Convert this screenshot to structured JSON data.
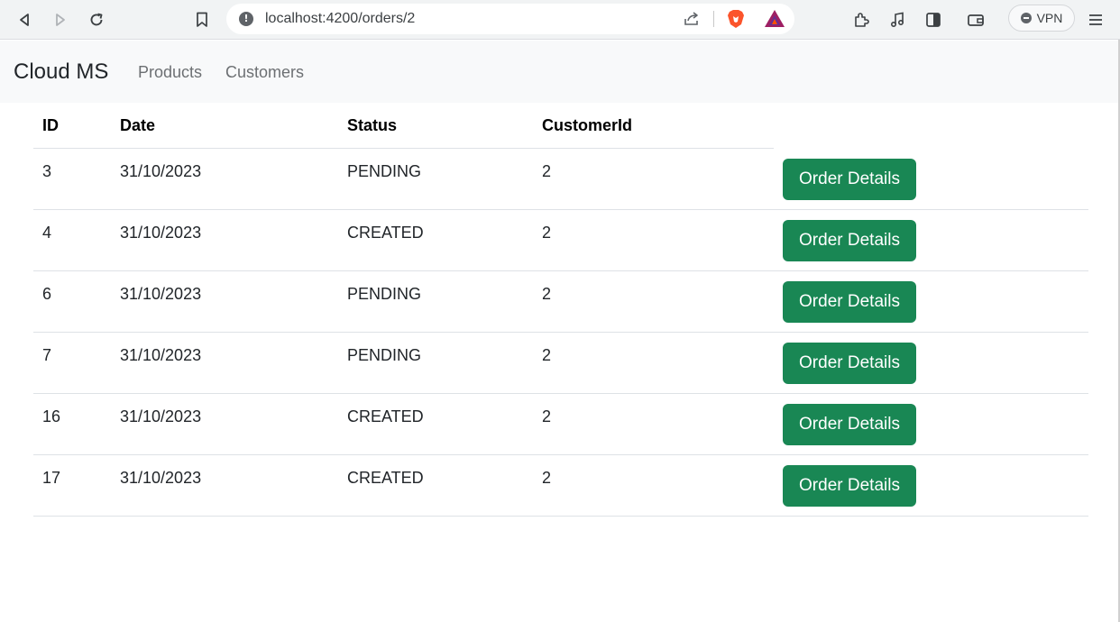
{
  "browser": {
    "url": "localhost:4200/orders/2",
    "vpn_label": "VPN",
    "icons": [
      "back-icon",
      "forward-icon",
      "reload-icon",
      "bookmark-icon",
      "site-info-icon",
      "share-icon",
      "brave-shields-icon",
      "brave-rewards-icon",
      "extensions-icon",
      "media-icon",
      "sidebar-icon",
      "wallet-icon",
      "menu-icon"
    ]
  },
  "navbar": {
    "brand": "Cloud MS",
    "links": [
      "Products",
      "Customers"
    ]
  },
  "table": {
    "headers": {
      "id": "ID",
      "date": "Date",
      "status": "Status",
      "customer_id": "CustomerId"
    },
    "button_label": "Order Details",
    "button_color": "#198754",
    "rows": [
      {
        "id": "3",
        "date": "31/10/2023",
        "status": "PENDING",
        "customer_id": "2"
      },
      {
        "id": "4",
        "date": "31/10/2023",
        "status": "CREATED",
        "customer_id": "2"
      },
      {
        "id": "6",
        "date": "31/10/2023",
        "status": "PENDING",
        "customer_id": "2"
      },
      {
        "id": "7",
        "date": "31/10/2023",
        "status": "PENDING",
        "customer_id": "2"
      },
      {
        "id": "16",
        "date": "31/10/2023",
        "status": "CREATED",
        "customer_id": "2"
      },
      {
        "id": "17",
        "date": "31/10/2023",
        "status": "CREATED",
        "customer_id": "2"
      }
    ]
  }
}
